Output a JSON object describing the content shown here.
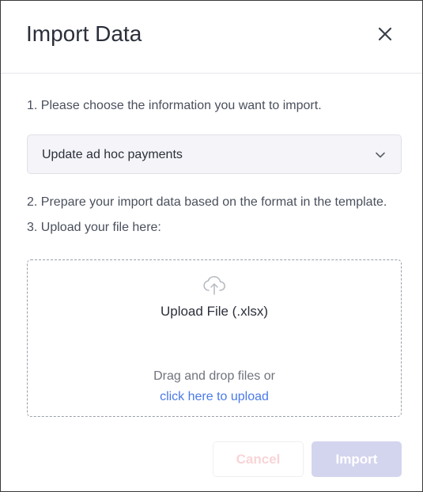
{
  "dialog": {
    "title": "Import Data",
    "close_icon": "close-icon"
  },
  "steps": {
    "step1": "1. Please choose the information you want to import.",
    "step2": "2. Prepare your import data based on the format in the template.",
    "step3": "3. Upload your file here:"
  },
  "import_type_select": {
    "selected_value": "Update ad hoc payments",
    "icon": "chevron-down-icon"
  },
  "dropzone": {
    "icon": "cloud-upload-icon",
    "title": "Upload File (.xlsx)",
    "drag_text": "Drag and drop files or",
    "upload_link": "click here to upload"
  },
  "footer": {
    "cancel_label": "Cancel",
    "import_label": "Import"
  },
  "colors": {
    "link": "#4a7ae8",
    "import_button_disabled": "#d3d5ee",
    "cancel_text_disabled": "#f9d4d7",
    "select_background": "#f5f5f9"
  }
}
